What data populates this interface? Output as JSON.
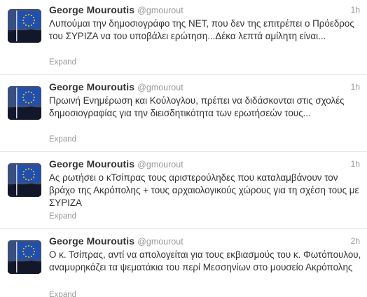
{
  "tweets": [
    {
      "fullname": "George Mouroutis",
      "username": "@gmourout",
      "time": "1h",
      "text": "Λυπούμαι την δημοσιογράφο της ΝΕΤ, που δεν της επιτρέπει ο Πρόεδρος του ΣΥΡΙΖΑ να του υποβάλει ερώτηση...Δέκα λεπτά αμίλητη είναι...",
      "expand": "Expand"
    },
    {
      "fullname": "George Mouroutis",
      "username": "@gmourout",
      "time": "1h",
      "text": "Πρωινή Ενημέρωση και Κούλογλου, πρέπει να διδάσκονται στις σχολές δημοσιογραφίας για την διεισδητικότητα των ερωτήσεών τους...",
      "expand": "Expand"
    },
    {
      "fullname": "George Mouroutis",
      "username": "@gmourout",
      "time": "1h",
      "text": "Ας ρωτήσει ο κΤσίπρας τους αριστερούληδες που καταλαμβάνουν τον βράχο της Ακρόπολης + τους αρχαιολογικούς χώρους για τη σχέση τους με ΣΥΡΙΖΑ",
      "expand": "Expand"
    },
    {
      "fullname": "George Mouroutis",
      "username": "@gmourout",
      "time": "2h",
      "text": "Ο κ. Τσίπρας, αντί να απολογείται για τους εκβιασμούς του κ. Φωτόπουλου, αναμυρηκάζει τα ψεματάκια του περί Μεσσηνίων στο μουσείο Ακρόπολης",
      "expand": "Expand"
    }
  ],
  "colors": {
    "name": "#333333",
    "meta": "#999999",
    "text": "#333333",
    "divider": "#e8e8e8",
    "avatar_sky": "#2e3f66",
    "eu_flag": "#1f4fb0",
    "eu_star": "#ffd200"
  },
  "icons": {
    "avatar": "eu-flag-acropolis-avatar"
  }
}
